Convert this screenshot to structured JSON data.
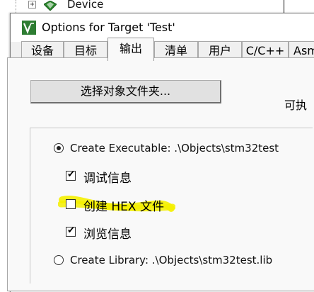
{
  "background_tree": {
    "expander_symbol": "+",
    "node_label": "Device",
    "node_icon": "gem-icon",
    "icon_color": "#2e8b2e"
  },
  "dialog": {
    "title": "Options for Target 'Test'",
    "app_icon": "keil-uvision-icon",
    "app_icon_color": "#2e7d32"
  },
  "tabs": [
    {
      "label": "设备",
      "active": false
    },
    {
      "label": "目标",
      "active": false
    },
    {
      "label": "输出",
      "active": true
    },
    {
      "label": "清单",
      "active": false
    },
    {
      "label": "用户",
      "active": false
    },
    {
      "label": "C/C++",
      "active": false
    },
    {
      "label": "Asm",
      "active": false
    }
  ],
  "output_tab": {
    "select_folder_button": "选择对象文件夹...",
    "side_label": "可执",
    "create_executable": {
      "label": "Create Executable:  .\\Objects\\stm32test",
      "selected": true
    },
    "options": [
      {
        "label": "调试信息",
        "checked": true
      },
      {
        "label": "创建 HEX 文件",
        "checked": false,
        "highlighted": true
      },
      {
        "label": "浏览信息",
        "checked": true
      }
    ],
    "create_library": {
      "label": "Create Library:  .\\Objects\\stm32test.lib",
      "selected": false
    }
  },
  "colors": {
    "highlight_marker": "#f5f000",
    "dialog_bg": "#f0f0f0",
    "page_bg": "#f9f9f9"
  }
}
